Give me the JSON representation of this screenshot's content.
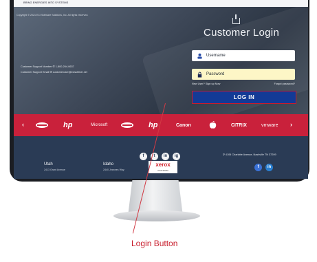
{
  "header": {
    "tagline": "BRING ENERGIES INTO SYSTEMS"
  },
  "login": {
    "title": "Customer Login",
    "username_placeholder": "Username",
    "password_placeholder": "Password",
    "signup_text": "New User? Sign up Now",
    "forgot_text": "Forgot password?",
    "login_button": "LOG IN"
  },
  "support": {
    "number_label": "Customer Support Number",
    "number": "1-800-264-0637",
    "email_label": "Customer Support Email",
    "email": "customercare@ecisoftech.net"
  },
  "brands": [
    "Panasonic",
    "hp",
    "Microsoft",
    "Samsung",
    "hp",
    "Canon",
    "Apple",
    "CITRIX",
    "vmware"
  ],
  "arrows": {
    "prev": "‹",
    "next": "›"
  },
  "footer": {
    "copyright": "Copyright © 2021 ECI Software Solutions, Inc. All rights reserved.",
    "address": "4106 Charlotte Avenue, Nashville TN 37209",
    "social": [
      "f",
      "t",
      "in",
      "ig"
    ],
    "locations": [
      {
        "name": "Utah",
        "address": "2413 Grant Avenue"
      },
      {
        "name": "Idaho",
        "address": "2440 Jeannes Way"
      }
    ],
    "xerox": {
      "name": "xerox",
      "tier": "PLATINUM"
    },
    "extra_social": [
      "f",
      "in"
    ]
  },
  "caption": "Login Button",
  "colors": {
    "brand_bar": "#c9213b",
    "login_button": "#133a96",
    "footer": "#2a3b55",
    "caption": "#c81f2e"
  }
}
